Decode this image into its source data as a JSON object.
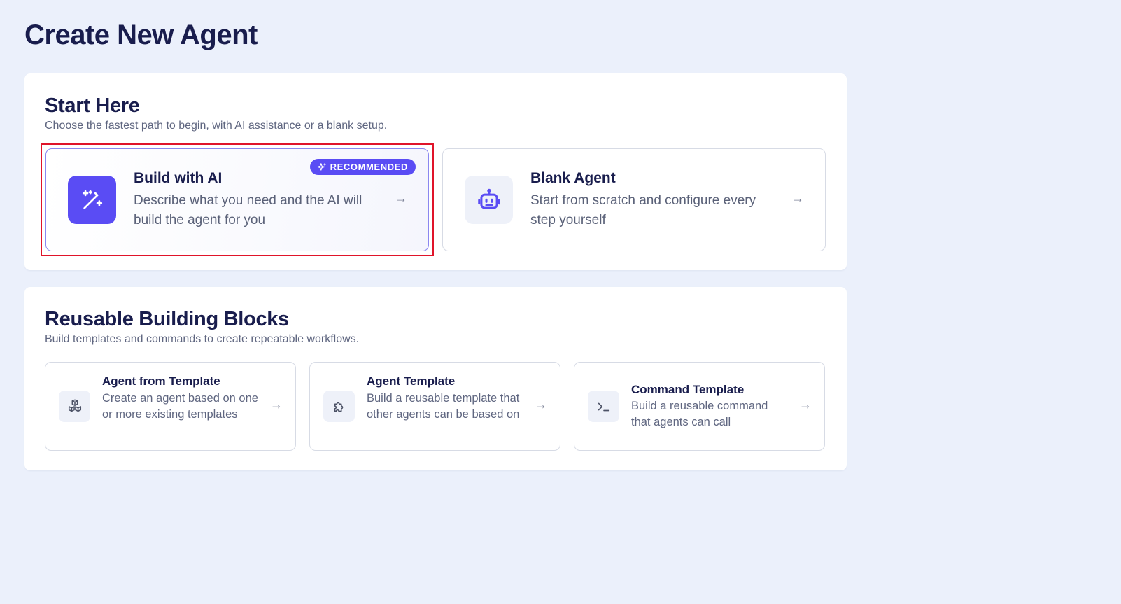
{
  "page_title": "Create New Agent",
  "start": {
    "title": "Start Here",
    "subtitle": "Choose the fastest path to begin, with AI assistance or a blank setup.",
    "build_ai": {
      "title": "Build with AI",
      "description": "Describe what you need and the AI will build the agent for you",
      "badge": "RECOMMENDED",
      "icon": "magic-wand-icon"
    },
    "blank": {
      "title": "Blank Agent",
      "description": "Start from scratch and configure every step yourself",
      "icon": "robot-icon"
    }
  },
  "blocks": {
    "title": "Reusable Building Blocks",
    "subtitle": "Build templates and commands to create repeatable workflows.",
    "cards": [
      {
        "title": "Agent from Template",
        "description": "Create an agent based on one or more existing templates",
        "icon": "boxes-icon"
      },
      {
        "title": "Agent Template",
        "description": "Build a reusable template that other agents can be based on",
        "icon": "puzzle-icon"
      },
      {
        "title": "Command Template",
        "description": "Build a reusable command that agents can call",
        "icon": "terminal-icon"
      }
    ]
  },
  "arrow_glyph": "→",
  "colors": {
    "accent": "#5a4cf4",
    "background": "#ebf0fb",
    "highlight": "#e0142a"
  }
}
